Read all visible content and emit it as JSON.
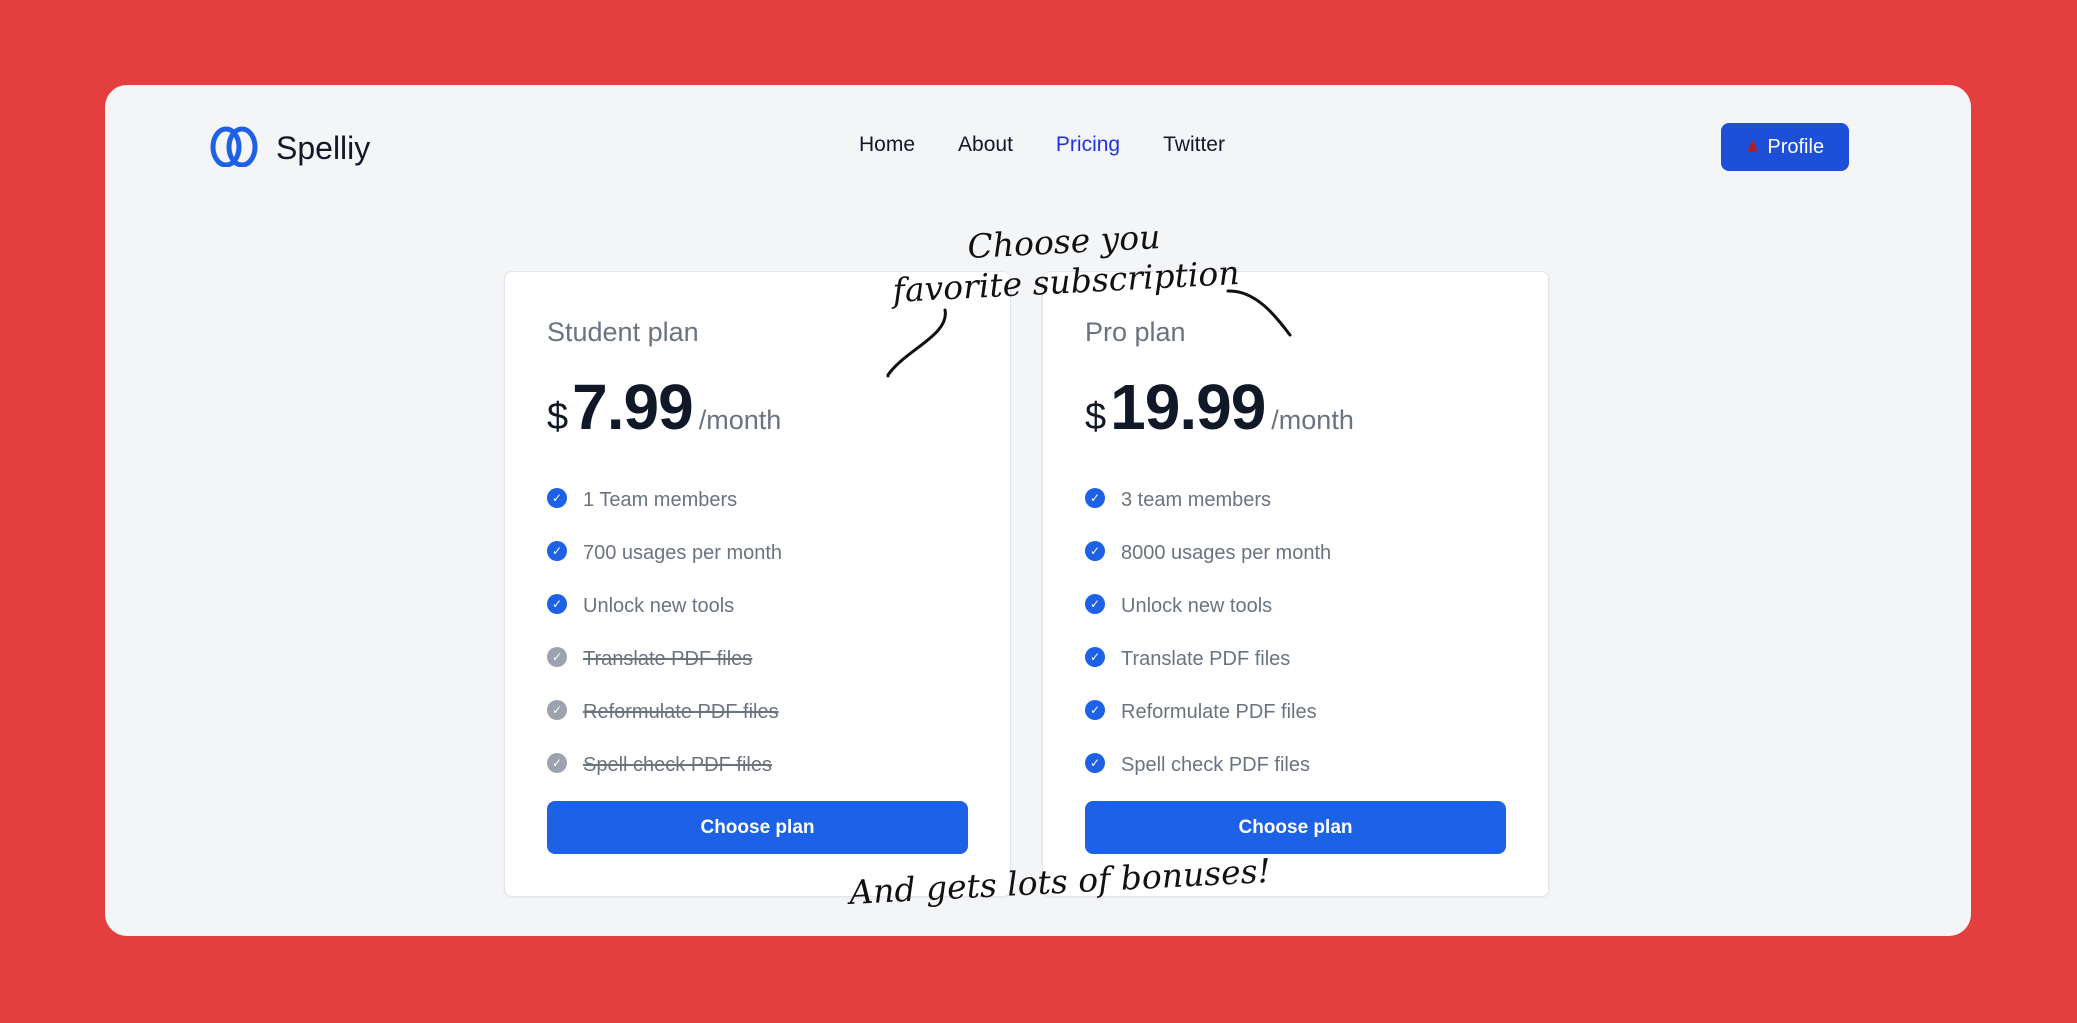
{
  "brand": {
    "name": "Spelliy",
    "logo_icon": "double-loop-logo-icon"
  },
  "nav": {
    "home": "Home",
    "about": "About",
    "pricing": "Pricing",
    "twitter": "Twitter",
    "active": "Pricing"
  },
  "profile_button": {
    "label": "Profile",
    "icon": "user-icon"
  },
  "annotations": {
    "top_line1": "Choose you",
    "top_line2": "favorite subscription",
    "bottom": "And gets lots of bonuses!"
  },
  "plans": [
    {
      "name": "Student plan",
      "currency": "$",
      "price": "7.99",
      "period": "/month",
      "features": [
        {
          "text": "1 Team members",
          "included": true
        },
        {
          "text": "700 usages per month",
          "included": true
        },
        {
          "text": "Unlock new tools",
          "included": true
        },
        {
          "text": "Translate PDF files",
          "included": false
        },
        {
          "text": "Reformulate PDF files",
          "included": false
        },
        {
          "text": "Spell check PDF files",
          "included": false
        }
      ],
      "button": "Choose plan"
    },
    {
      "name": "Pro plan",
      "currency": "$",
      "price": "19.99",
      "period": "/month",
      "features": [
        {
          "text": "3 team members",
          "included": true
        },
        {
          "text": "8000 usages per month",
          "included": true
        },
        {
          "text": "Unlock new tools",
          "included": true
        },
        {
          "text": "Translate PDF files",
          "included": true
        },
        {
          "text": "Reformulate PDF files",
          "included": true
        },
        {
          "text": "Spell check PDF files",
          "included": true
        }
      ],
      "button": "Choose plan"
    }
  ],
  "colors": {
    "background": "#e53e3e",
    "primary": "#1d61e6",
    "nav_active": "#1d34e0",
    "check_included": "#1d61e6",
    "check_excluded": "#9ca3af"
  }
}
